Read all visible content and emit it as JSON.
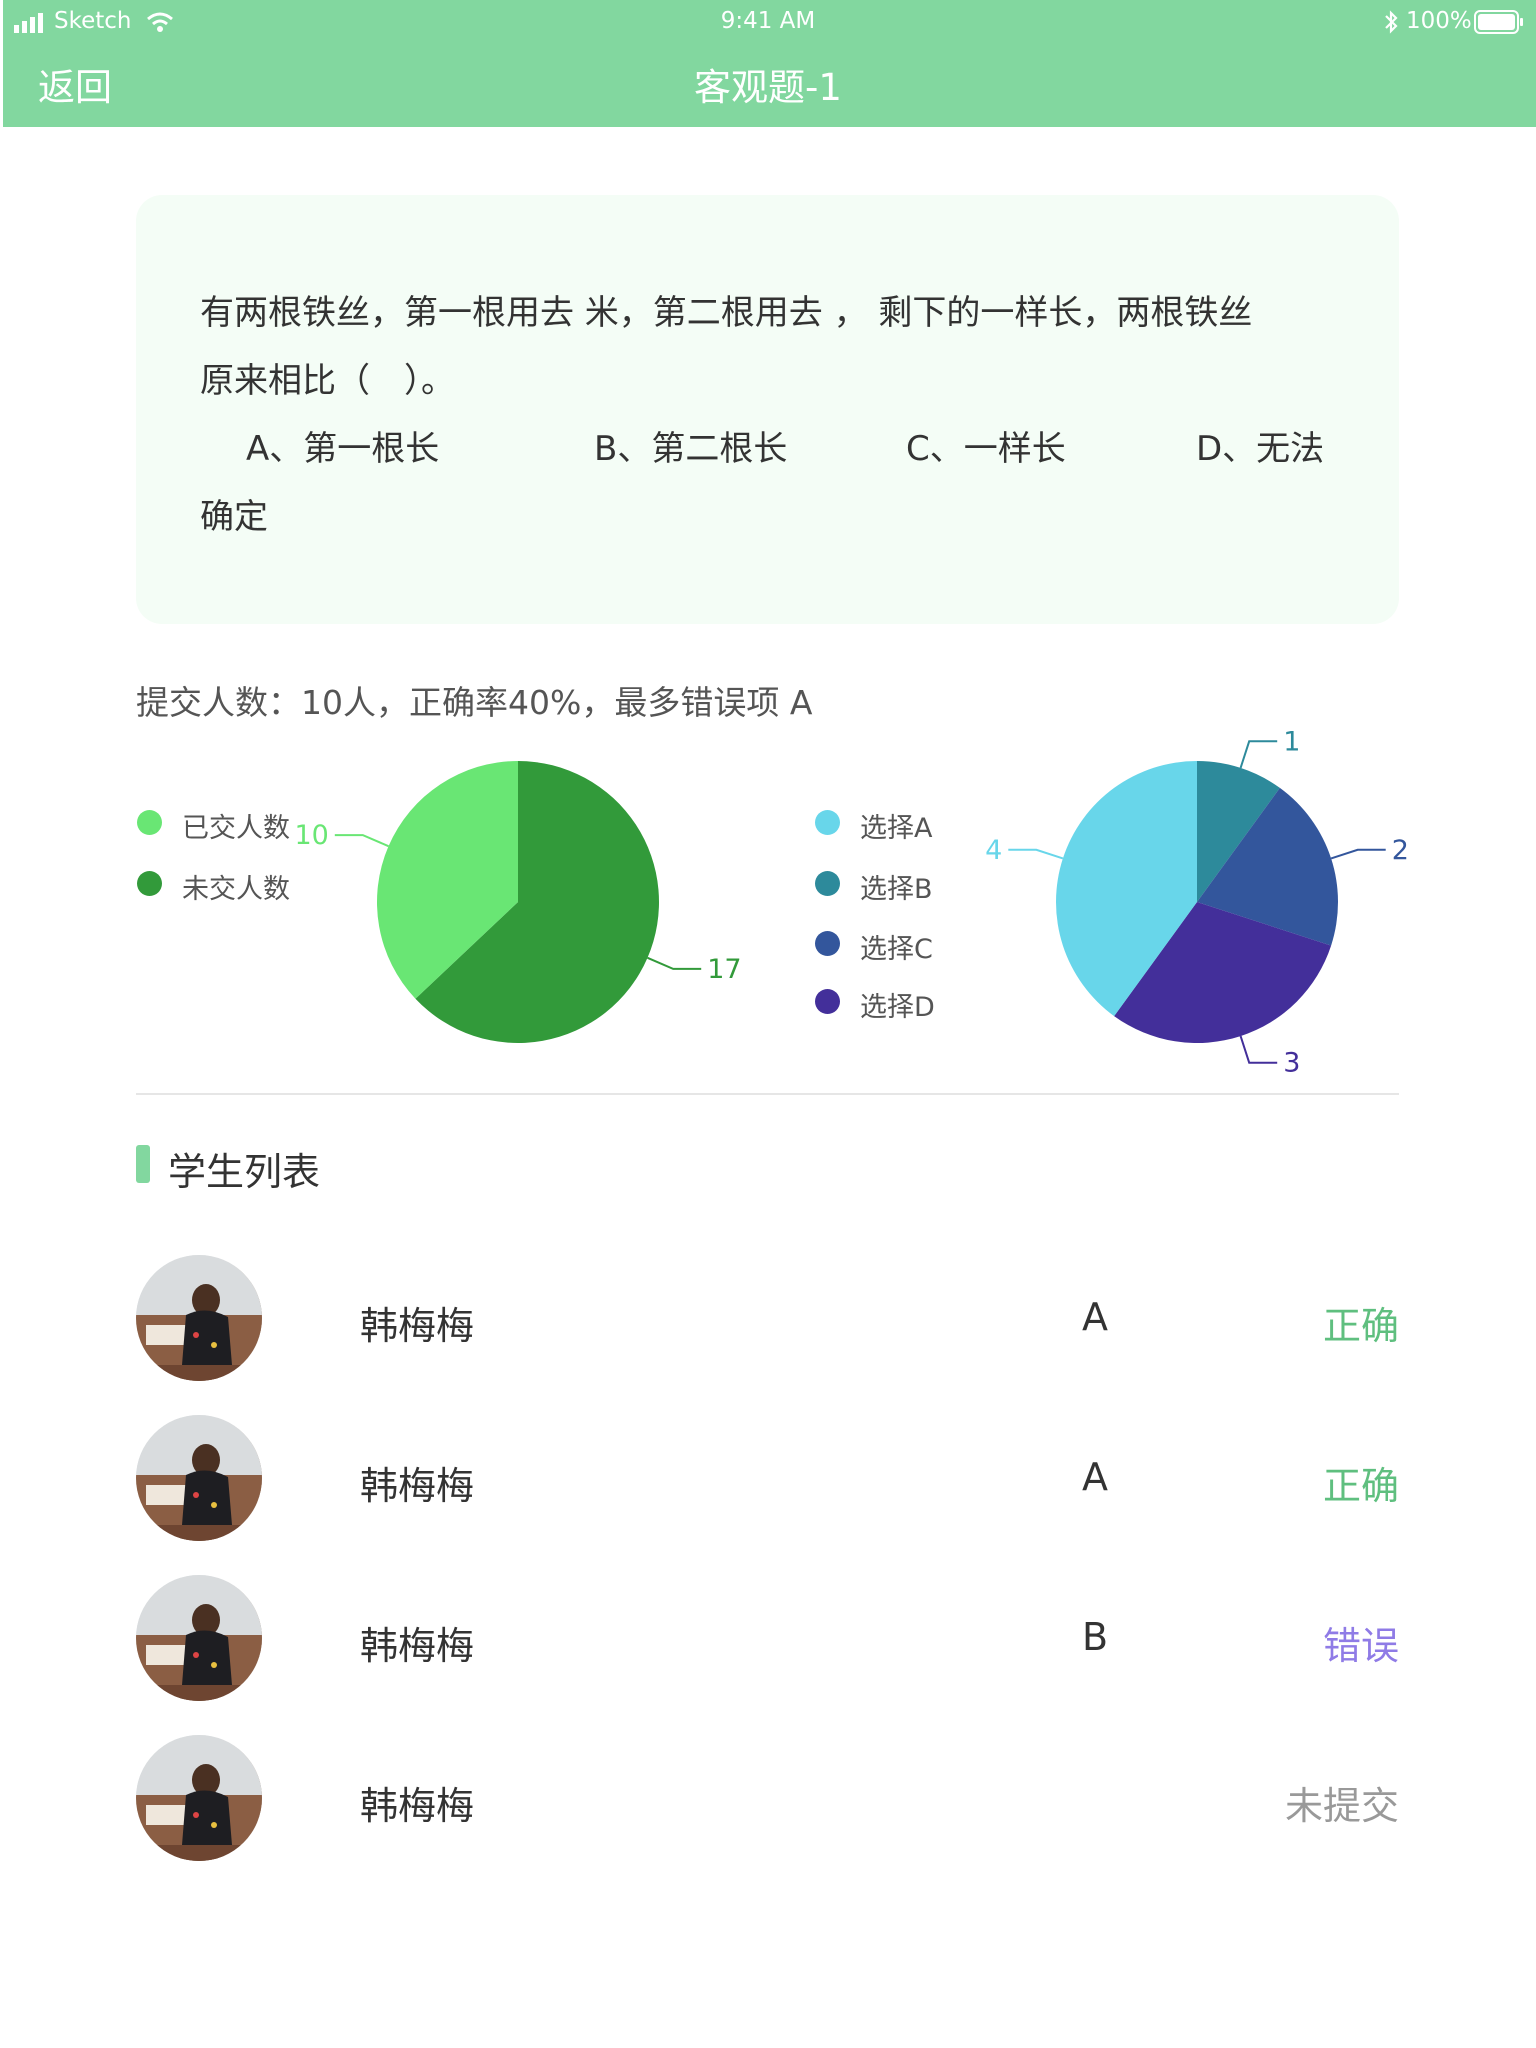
{
  "status_bar": {
    "carrier": "Sketch",
    "time": "9:41 AM",
    "battery": "100%",
    "icons": [
      "signal-icon",
      "wifi-icon",
      "bluetooth-icon",
      "battery-icon"
    ]
  },
  "nav": {
    "back": "返回",
    "title": "客观题-1"
  },
  "question": {
    "line1": "有两根铁丝，第一根用去 米，第二根用去 ， 剩下的一样长，两根铁丝",
    "line2": "原来相比（　）。",
    "options": [
      "A、第一根长",
      "B、第二根长",
      "C、一样长",
      "D、无法"
    ],
    "line4": "确定"
  },
  "summary": "提交人数：10人，正确率40%，最多错误项 A",
  "legend_submit": [
    {
      "label": "已交人数",
      "color": "#69e674"
    },
    {
      "label": "未交人数",
      "color": "#329a3a"
    }
  ],
  "legend_choice": [
    {
      "label": "选择A",
      "color": "#68d6ea"
    },
    {
      "label": "选择B",
      "color": "#2d8a9b"
    },
    {
      "label": "选择C",
      "color": "#33569c"
    },
    {
      "label": "选择D",
      "color": "#432f9a"
    }
  ],
  "chart_data": [
    {
      "type": "pie",
      "categories": [
        "已交人数",
        "未交人数"
      ],
      "values": [
        10,
        17
      ],
      "colors": [
        "#69e674",
        "#329a3a"
      ],
      "data_labels": [
        "10",
        "17"
      ]
    },
    {
      "type": "pie",
      "categories": [
        "选择A",
        "选择B",
        "选择C",
        "选择D"
      ],
      "values": [
        4,
        1,
        2,
        3
      ],
      "colors": [
        "#68d6ea",
        "#2d8a9b",
        "#33569c",
        "#432f9a"
      ],
      "data_labels": [
        "4",
        "1",
        "2",
        "3"
      ]
    }
  ],
  "section": {
    "title": "学生列表"
  },
  "students": [
    {
      "name": "韩梅梅",
      "answer": "A",
      "status": "正确",
      "status_color": "#5fbf7f"
    },
    {
      "name": "韩梅梅",
      "answer": "A",
      "status": "正确",
      "status_color": "#5fbf7f"
    },
    {
      "name": "韩梅梅",
      "answer": "B",
      "status": "错误",
      "status_color": "#8f7be6"
    },
    {
      "name": "韩梅梅",
      "answer": "",
      "status": "未提交",
      "status_color": "#999999"
    }
  ]
}
